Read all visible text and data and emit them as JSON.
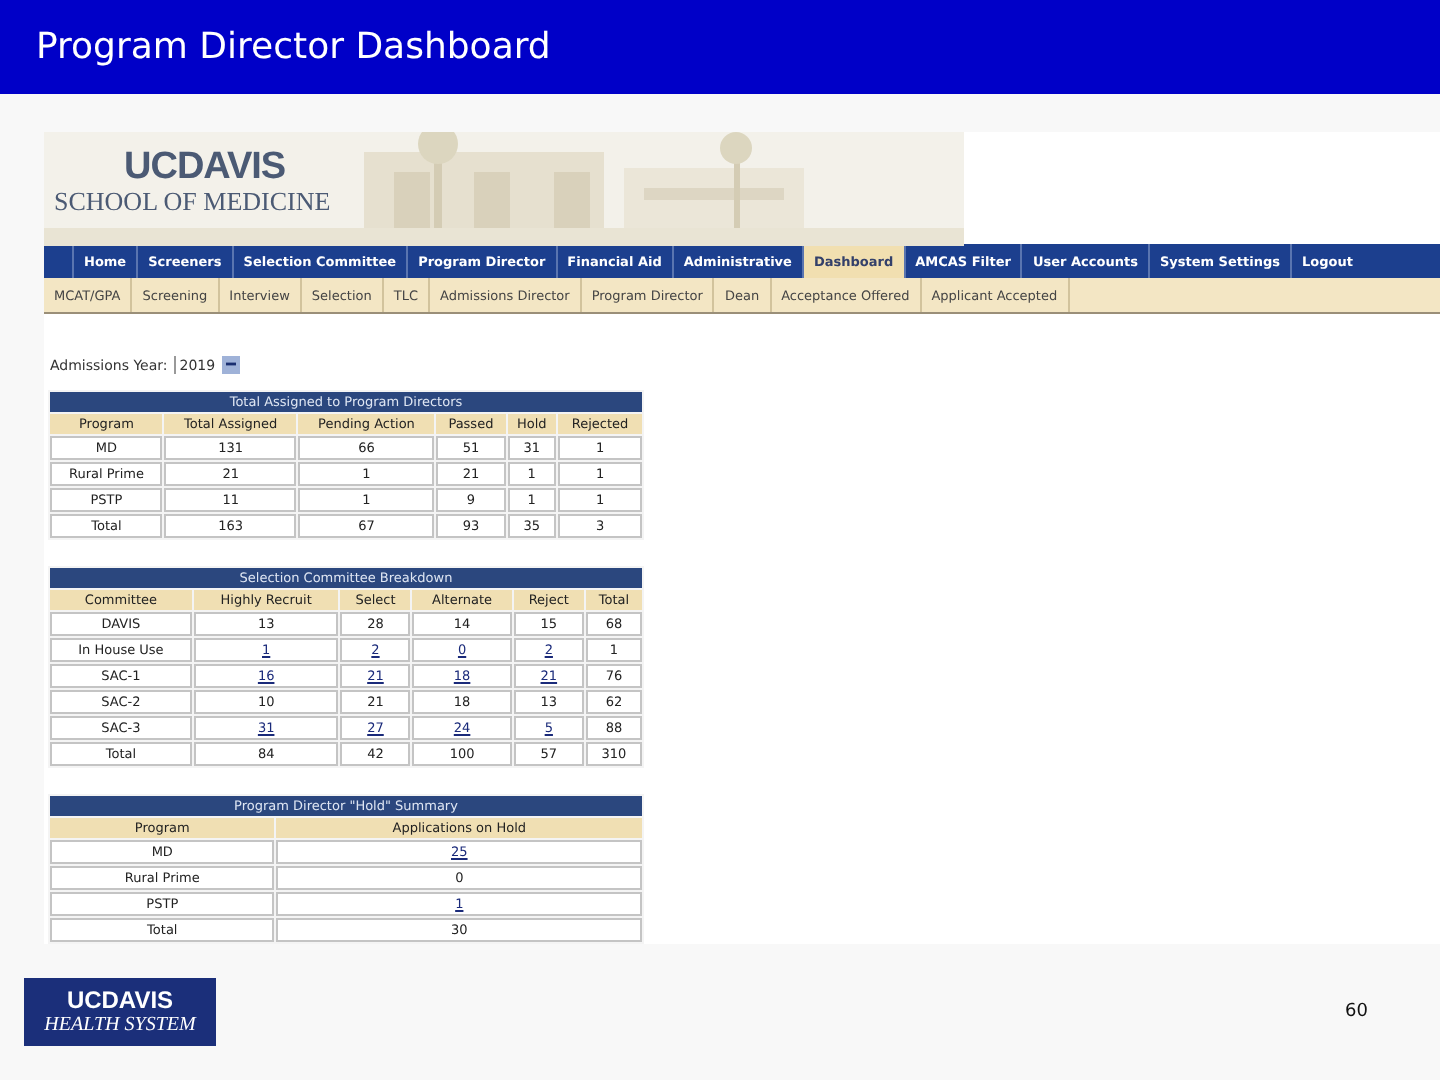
{
  "slide_title": "Program Director Dashboard",
  "site": {
    "logo_top": "UCDAVIS",
    "logo_bottom": "SCHOOL OF MEDICINE",
    "nav": [
      {
        "label": "Home",
        "selected": false
      },
      {
        "label": "Screeners",
        "selected": false
      },
      {
        "label": "Selection Committee",
        "selected": false
      },
      {
        "label": "Program Director",
        "selected": false
      },
      {
        "label": "Financial Aid",
        "selected": false
      },
      {
        "label": "Administrative",
        "selected": false
      },
      {
        "label": "Dashboard",
        "selected": true
      },
      {
        "label": "AMCAS Filter",
        "selected": false
      },
      {
        "label": "User Accounts",
        "selected": false
      },
      {
        "label": "System Settings",
        "selected": false
      },
      {
        "label": "Logout",
        "selected": false
      }
    ],
    "subnav": [
      "MCAT/GPA",
      "Screening",
      "Interview",
      "Selection",
      "TLC",
      "Admissions Director",
      "Program Director",
      "Dean",
      "Acceptance Offered",
      "Applicant Accepted"
    ],
    "year_filter": {
      "label": "Admissions Year:",
      "value": "2019"
    },
    "tables": [
      {
        "title": "Total Assigned to Program Directors",
        "columns": [
          "Program",
          "Total Assigned",
          "Pending Action",
          "Passed",
          "Hold",
          "Rejected"
        ],
        "rows": [
          [
            "MD",
            "131",
            "66",
            "51",
            "31",
            "1"
          ],
          [
            "Rural Prime",
            "21",
            "1",
            "21",
            "1",
            "1"
          ],
          [
            "PSTP",
            "11",
            "1",
            "9",
            "1",
            "1"
          ],
          [
            "Total",
            "163",
            "67",
            "93",
            "35",
            "3"
          ]
        ]
      },
      {
        "title": "Selection Committee Breakdown",
        "columns": [
          "Committee",
          "Highly Recruit",
          "Select",
          "Alternate",
          "Reject",
          "Total"
        ],
        "rows": [
          [
            "DAVIS",
            "13",
            "28",
            "14",
            "15",
            "68"
          ],
          [
            "In House Use",
            {
              "text": "1",
              "link": true
            },
            {
              "text": "2",
              "link": true
            },
            {
              "text": "0",
              "link": true
            },
            {
              "text": "2",
              "link": true
            },
            "1"
          ],
          [
            "SAC-1",
            {
              "text": "16",
              "link": true
            },
            {
              "text": "21",
              "link": true
            },
            {
              "text": "18",
              "link": true
            },
            {
              "text": "21",
              "link": true
            },
            "76"
          ],
          [
            "SAC-2",
            "10",
            "21",
            "18",
            "13",
            "62"
          ],
          [
            "SAC-3",
            {
              "text": "31",
              "link": true
            },
            {
              "text": "27",
              "link": true
            },
            {
              "text": "24",
              "link": true
            },
            {
              "text": "5",
              "link": true
            },
            "88"
          ],
          [
            "Total",
            "84",
            "42",
            "100",
            "57",
            "310"
          ]
        ]
      },
      {
        "title": "Program Director \"Hold\" Summary",
        "columns": [
          "Program",
          "Applications on Hold"
        ],
        "rows": [
          [
            "MD",
            {
              "text": "25",
              "link": true
            }
          ],
          [
            "Rural Prime",
            "0"
          ],
          [
            "PSTP",
            {
              "text": "1",
              "link": true
            }
          ],
          [
            "Total",
            "30"
          ]
        ]
      }
    ]
  },
  "footer": {
    "logo_top": "UCDAVIS",
    "logo_bottom": "HEALTH SYSTEM",
    "page_number": "60"
  }
}
